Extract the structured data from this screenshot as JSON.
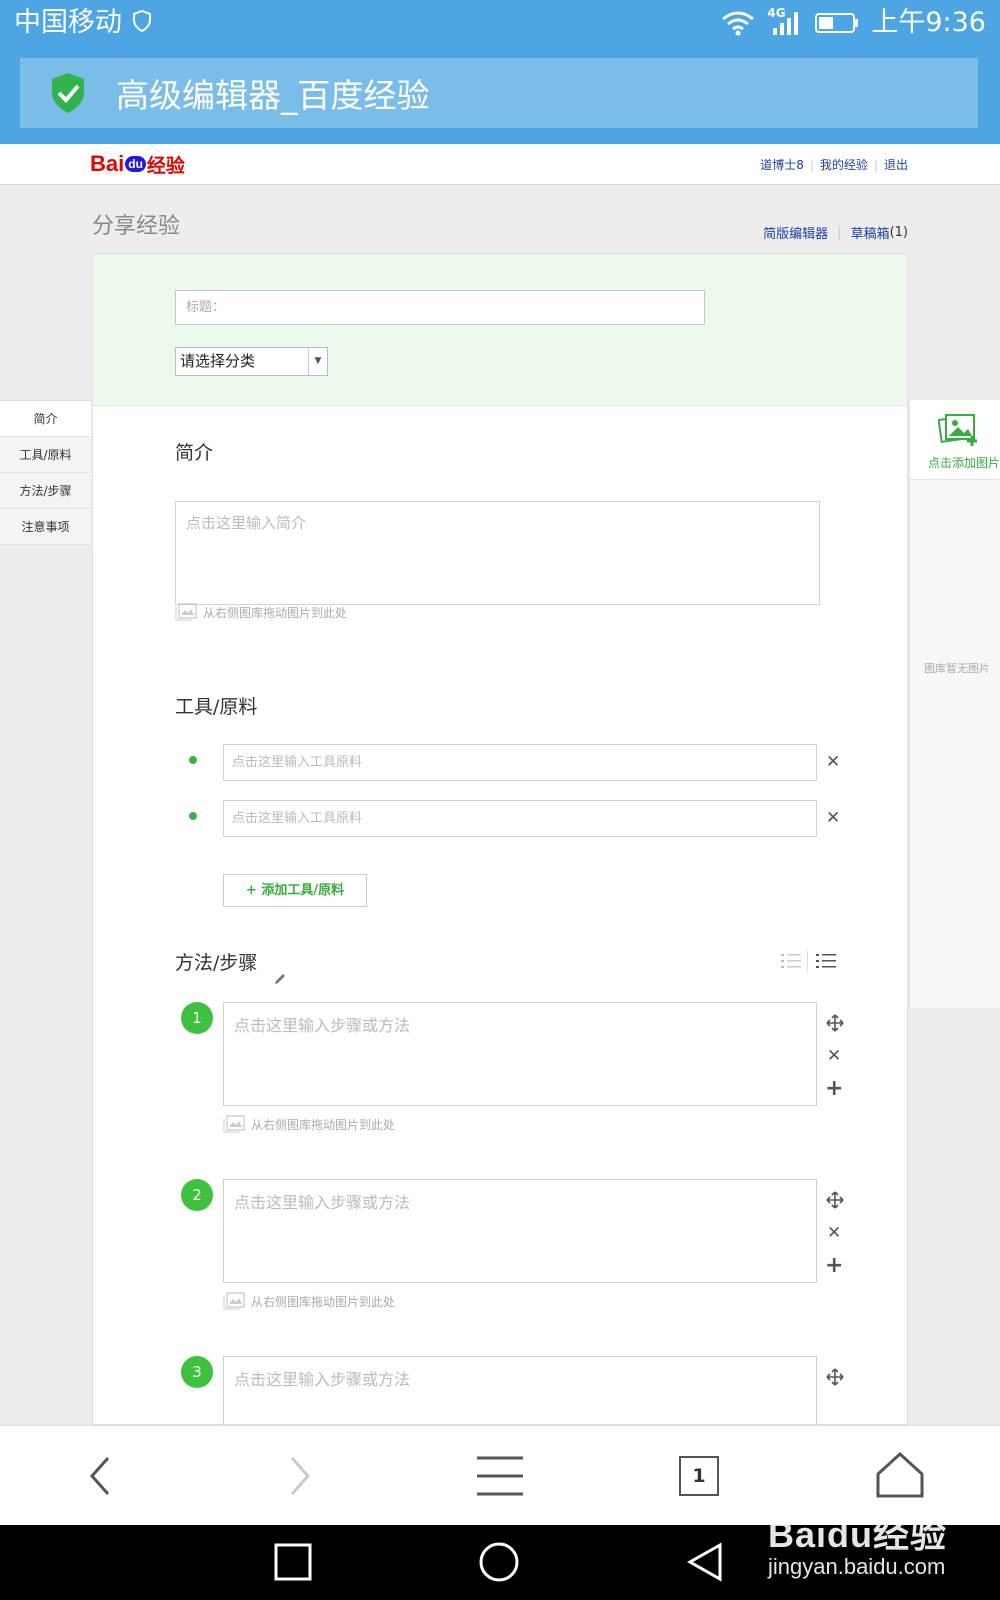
{
  "status_bar": {
    "carrier": "中国移动",
    "network": "4G",
    "time": "上午9:36"
  },
  "browser": {
    "page_title": "高级编辑器_百度经验",
    "tab_count": "1"
  },
  "site": {
    "logo_bai": "Bai",
    "logo_du": "du",
    "logo_jingyan": "经验",
    "user_links": [
      "道博士8",
      "我的经验",
      "退出"
    ]
  },
  "page": {
    "heading": "分享经验",
    "simple_editor": "简版编辑器",
    "drafts": "草稿箱",
    "drafts_count": "(1)"
  },
  "form": {
    "title_placeholder": "标题：",
    "category_selected": "请选择分类"
  },
  "left_nav": [
    "简介",
    "工具/原料",
    "方法/步骤",
    "注意事项"
  ],
  "intro": {
    "title": "简介",
    "placeholder": "点击这里输入简介",
    "drag_hint": "从右侧图库拖动图片到此处"
  },
  "tools": {
    "title": "工具/原料",
    "items": [
      {
        "placeholder": "点击这里输入工具原料"
      },
      {
        "placeholder": "点击这里输入工具原料"
      }
    ],
    "add_label": "+ 添加工具/原料"
  },
  "steps": {
    "title": "方法/步骤",
    "items": [
      {
        "number": "1",
        "placeholder": "点击这里输入步骤或方法",
        "drag_hint": "从右侧图库拖动图片到此处"
      },
      {
        "number": "2",
        "placeholder": "点击这里输入步骤或方法",
        "drag_hint": "从右侧图库拖动图片到此处"
      },
      {
        "number": "3",
        "placeholder": "点击这里输入步骤或方法"
      }
    ]
  },
  "gallery": {
    "add_label": "点击添加图片",
    "empty_text": "图库暂无图片"
  },
  "watermark": {
    "logo": "Baidu经验",
    "url": "jingyan.baidu.com"
  },
  "colors": {
    "accent_blue": "#4da5e3",
    "brand_green": "#3ec13f",
    "link_blue": "#1a3fa6",
    "baidu_red": "#e10602"
  }
}
